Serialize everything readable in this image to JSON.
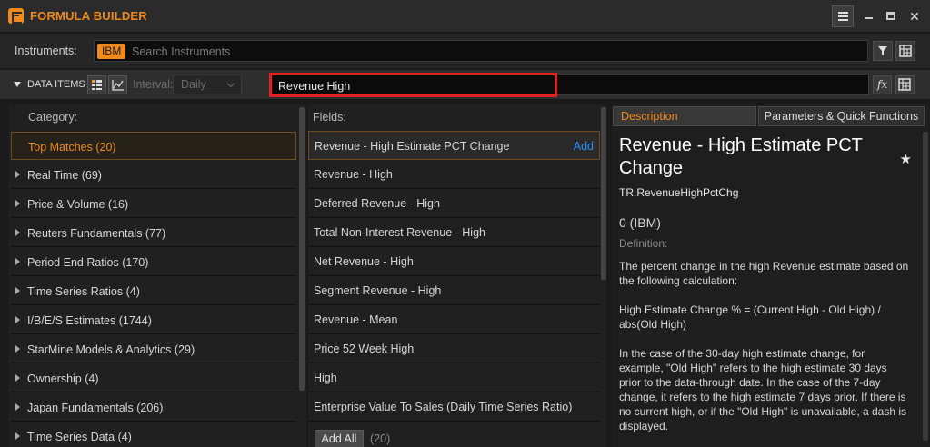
{
  "window": {
    "title": "FORMULA BUILDER",
    "close_glyph": "✕"
  },
  "instruments": {
    "label": "Instruments:",
    "chip": "IBM",
    "placeholder": "Search Instruments"
  },
  "data_items": {
    "label": "DATA ITEMS",
    "interval_label": "Interval:",
    "interval_value": "Daily",
    "search_value": "Revenue High",
    "fx_label": "fx"
  },
  "categories": {
    "header": "Category:",
    "items": [
      {
        "label": "Top Matches (20)"
      },
      {
        "label": "Real Time (69)"
      },
      {
        "label": "Price & Volume (16)"
      },
      {
        "label": "Reuters Fundamentals (77)"
      },
      {
        "label": "Period End Ratios (170)"
      },
      {
        "label": "Time Series Ratios (4)"
      },
      {
        "label": "I/B/E/S Estimates (1744)"
      },
      {
        "label": "StarMine Models & Analytics (29)"
      },
      {
        "label": "Ownership (4)"
      },
      {
        "label": "Japan Fundamentals (206)"
      },
      {
        "label": "Time Series Data (4)"
      }
    ]
  },
  "fields": {
    "header": "Fields:",
    "add_label": "Add",
    "items": [
      {
        "label": "Revenue - High Estimate PCT Change"
      },
      {
        "label": "Revenue - High"
      },
      {
        "label": "Deferred Revenue - High"
      },
      {
        "label": "Total Non-Interest Revenue - High"
      },
      {
        "label": "Net Revenue - High"
      },
      {
        "label": "Segment Revenue - High"
      },
      {
        "label": "Revenue - Mean"
      },
      {
        "label": "Price 52 Week High"
      },
      {
        "label": "High"
      },
      {
        "label": "Enterprise Value To Sales (Daily Time Series Ratio)"
      }
    ],
    "add_all_label": "Add All",
    "count": "(20)"
  },
  "description": {
    "tab_description": "Description",
    "tab_params": "Parameters & Quick Functions",
    "title": "Revenue - High Estimate PCT Change",
    "code": "TR.RevenueHighPctChg",
    "value": "0 (IBM)",
    "definition_label": "Definition:",
    "para1": "The percent change in the high Revenue estimate based on the following calculation:",
    "para2": "High Estimate Change % = (Current High - Old High) / abs(Old High)",
    "para3": "In the case of the 30-day high estimate change, for example, \"Old High\" refers to the high estimate 30 days prior to the data-through date. In the case of the 7-day change, it refers to the high estimate 7 days prior. If there is no current high, or if the \"Old High\" is unavailable, a dash is displayed."
  },
  "colors": {
    "accent": "#f08a1c",
    "link": "#2f8cff",
    "highlight": "#e02222"
  }
}
